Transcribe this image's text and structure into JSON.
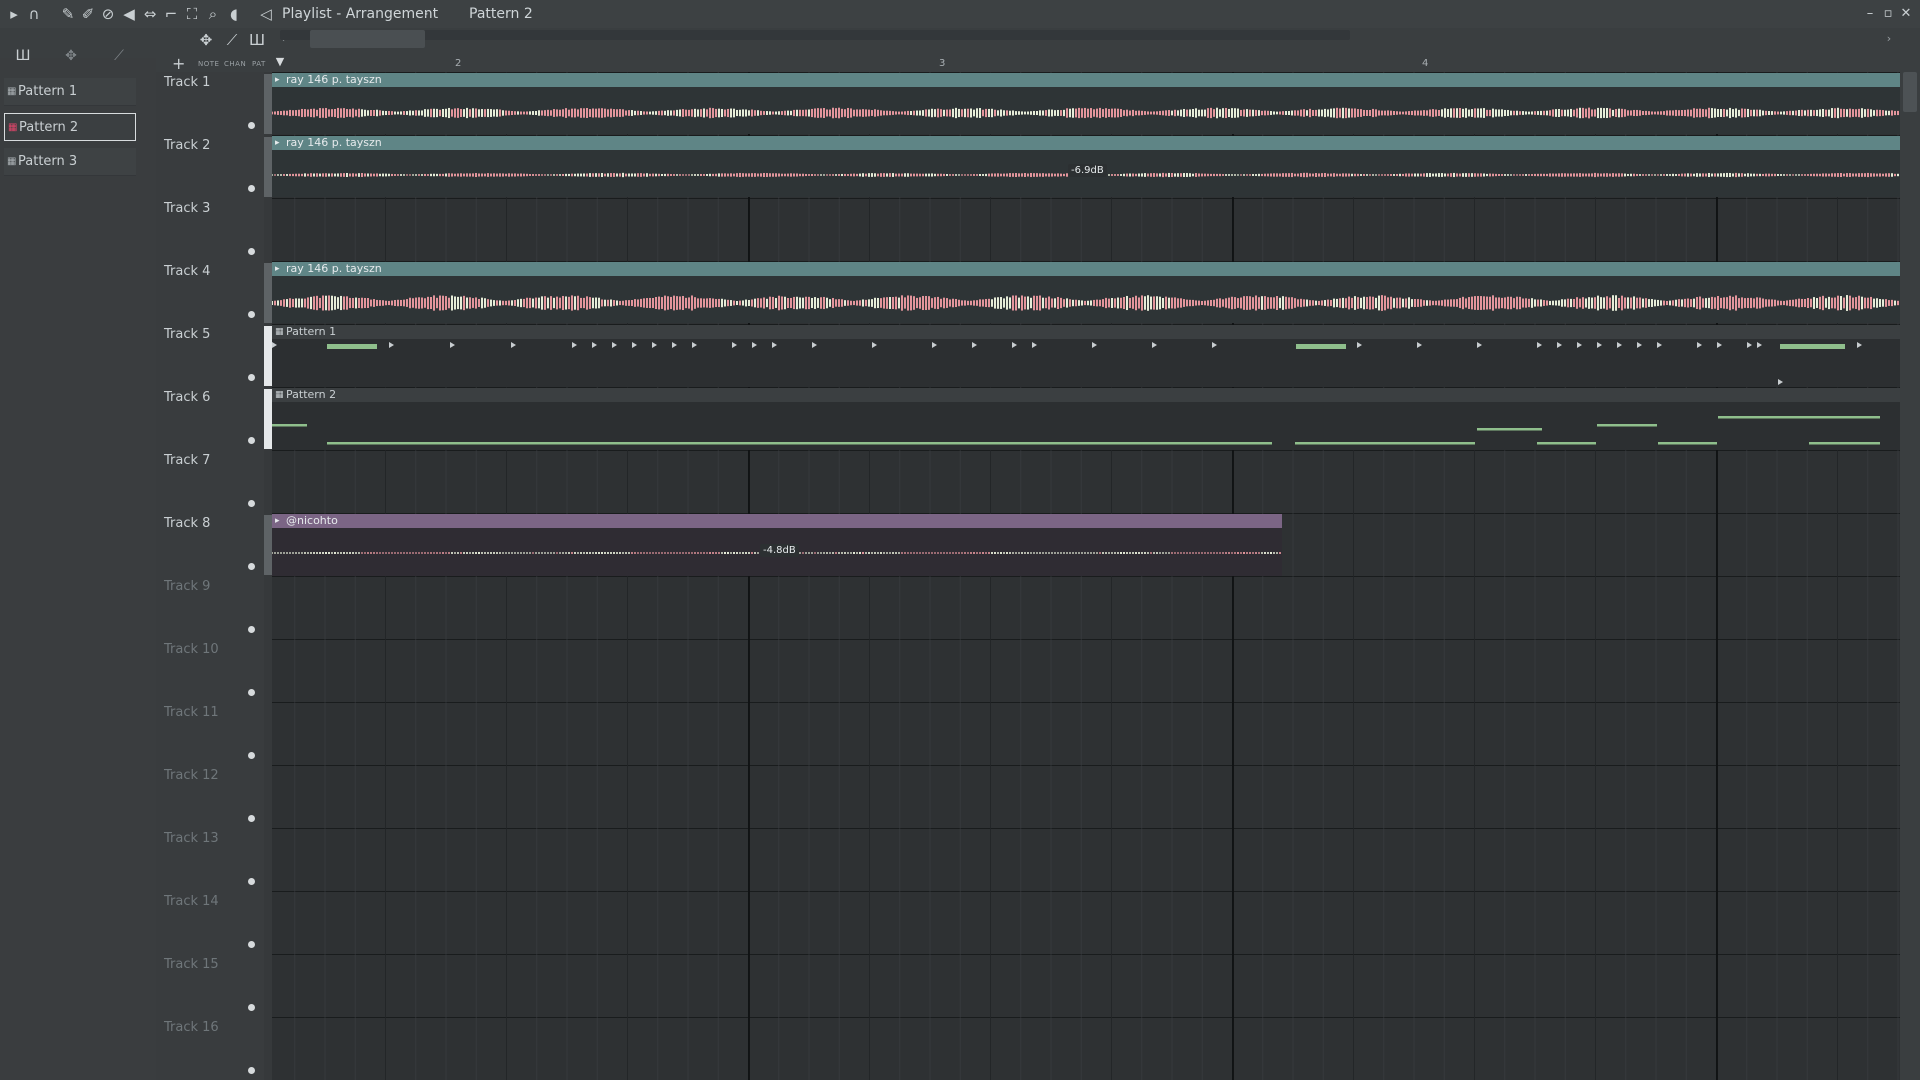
{
  "window": {
    "title": "Playlist - Arrangement",
    "breadcrumb_sep": "›",
    "current_pattern": "Pattern 2",
    "crumb_arrow": "›"
  },
  "toolbar_icons": [
    "play-arrow-icon",
    "magnet-icon",
    "pencil-icon",
    "paint-brush-icon",
    "delete-icon",
    "mute-icon",
    "slip-icon",
    "slice-icon",
    "select-icon",
    "zoom-icon",
    "playback-icon",
    "audio-icon"
  ],
  "picker": {
    "patterns": [
      {
        "label": "Pattern 1"
      },
      {
        "label": "Pattern 2"
      },
      {
        "label": "Pattern 3"
      }
    ],
    "header_labels": {
      "note": "NOTE",
      "chan": "CHAN",
      "pat": "PAT"
    }
  },
  "ruler": {
    "bars": [
      "2",
      "3",
      "4"
    ]
  },
  "tracks": [
    {
      "label": "Track 1"
    },
    {
      "label": "Track 2"
    },
    {
      "label": "Track 3"
    },
    {
      "label": "Track 4"
    },
    {
      "label": "Track 5"
    },
    {
      "label": "Track 6"
    },
    {
      "label": "Track 7"
    },
    {
      "label": "Track 8"
    },
    {
      "label": "Track 9"
    },
    {
      "label": "Track 10"
    },
    {
      "label": "Track 11"
    },
    {
      "label": "Track 12"
    },
    {
      "label": "Track 13"
    },
    {
      "label": "Track 14"
    },
    {
      "label": "Track 15"
    },
    {
      "label": "Track 16"
    }
  ],
  "clips": {
    "track1": {
      "name": "ray 146 p. tayszn"
    },
    "track2": {
      "name": "ray 146 p. tayszn",
      "gain": "-6.9dB"
    },
    "track4": {
      "name": "ray 146 p. tayszn"
    },
    "track5": {
      "name": "Pattern 1"
    },
    "track6": {
      "name": "Pattern 2"
    },
    "track8": {
      "name": "@nicohto",
      "gain": "-4.8dB"
    }
  },
  "colors": {
    "audio_clip_header": "#5f8586",
    "purple_clip_header": "#7b6585",
    "waveform_pink": "#e3959c",
    "waveform_light": "#e6ecd8",
    "note_green": "#8fbf8c"
  }
}
